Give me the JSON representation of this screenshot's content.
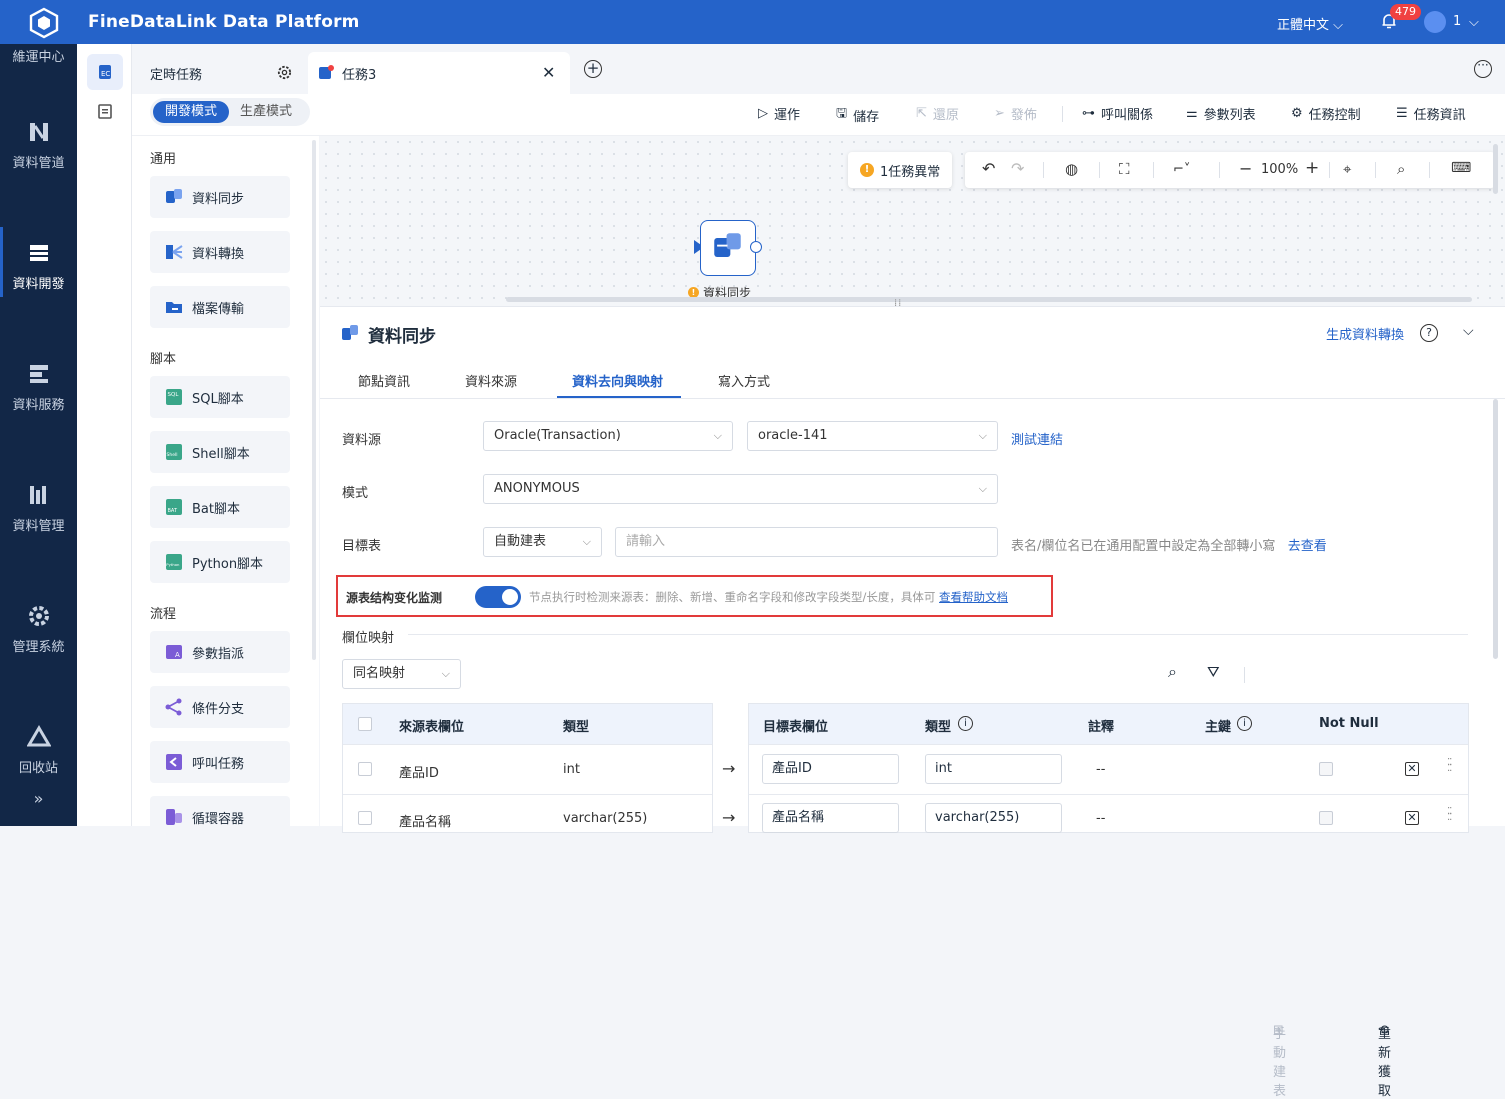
{
  "app": {
    "title": "FineDataLink Data Platform",
    "language": "正體中文",
    "notifications": "479",
    "user": "1"
  },
  "leftnav": {
    "items": [
      {
        "label": "維運中心"
      },
      {
        "label": "資料管道"
      },
      {
        "label": "資料開發"
      },
      {
        "label": "資料服務"
      },
      {
        "label": "資料管理"
      },
      {
        "label": "管理系統"
      },
      {
        "label": "回收站"
      }
    ],
    "collapse": "»"
  },
  "tabs": {
    "schedule": "定時任務",
    "task": "任務3"
  },
  "toolbar": {
    "mode_dev": "開發模式",
    "mode_prod": "生產模式",
    "run": "運作",
    "save": "儲存",
    "restore": "還原",
    "publish": "發佈",
    "call_relation": "呼叫關係",
    "param_list": "參數列表",
    "task_control": "任務控制",
    "task_info": "任務資訊"
  },
  "palette": {
    "groups": [
      {
        "title": "通用",
        "items": [
          "資料同步",
          "資料轉換",
          "檔案傳輸"
        ]
      },
      {
        "title": "腳本",
        "items": [
          "SQL腳本",
          "Shell腳本",
          "Bat腳本",
          "Python腳本"
        ]
      },
      {
        "title": "流程",
        "items": [
          "參數指派",
          "條件分支",
          "呼叫任務",
          "循環容器"
        ]
      }
    ]
  },
  "canvas": {
    "warning": "1任務異常",
    "zoom": "100%",
    "node_label": "資料同步"
  },
  "panel": {
    "title": "資料同步",
    "generate_link": "生成資料轉換",
    "tabs": [
      "節點資訊",
      "資料來源",
      "資料去向與映射",
      "寫入方式"
    ],
    "datasource_label": "資料源",
    "datasource_type": "Oracle(Transaction)",
    "datasource_conn": "oracle-141",
    "test_link": "測試連結",
    "schema_label": "模式",
    "schema_value": "ANONYMOUS",
    "target_label": "目標表",
    "target_mode": "自動建表",
    "target_placeholder": "請輸入",
    "target_note": "表名/欄位名已在通用配置中設定為全部轉小寫",
    "target_note_link": "去查看",
    "monitor_label": "源表结构变化监测",
    "monitor_desc": "节点执行时检测来源表：删除、新增、重命名字段和修改字段类型/长度，具体可",
    "monitor_link": "查看帮助文档",
    "mapping_title": "欄位映射",
    "mapping_mode": "同名映射",
    "manual_create": "手動建表",
    "refetch": "重新獲取"
  },
  "source_table": {
    "headers": [
      "來源表欄位",
      "類型"
    ],
    "rows": [
      {
        "field": "產品ID",
        "type": "int"
      },
      {
        "field": "產品名稱",
        "type": "varchar(255)"
      }
    ]
  },
  "target_table": {
    "headers": [
      "目標表欄位",
      "類型",
      "註釋",
      "主鍵",
      "Not Null"
    ],
    "rows": [
      {
        "field": "產品ID",
        "type": "int",
        "comment": "--"
      },
      {
        "field": "產品名稱",
        "type": "varchar(255)",
        "comment": "--"
      }
    ]
  },
  "colors": {
    "brand": "#2563c9",
    "nav_bg": "#122747",
    "highlight": "#e23a3a"
  }
}
